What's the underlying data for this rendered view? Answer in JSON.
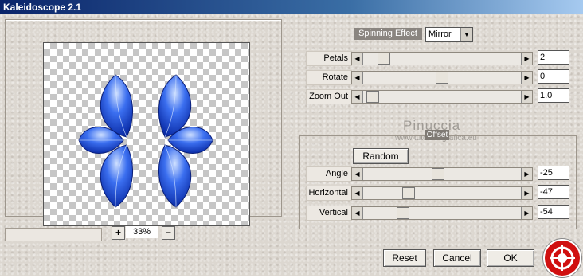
{
  "window": {
    "title": "Kaleidoscope 2.1"
  },
  "preview": {
    "zoom_minus": "−",
    "zoom_plus": "+",
    "zoom_value": "33%"
  },
  "effect": {
    "label": "Spinning Effect",
    "mode": "Mirror"
  },
  "params": {
    "petals": {
      "label": "Petals",
      "value": "2",
      "level": 0.1
    },
    "rotate": {
      "label": "Rotate",
      "value": "0",
      "level": 0.5
    },
    "zoom_out": {
      "label": "Zoom Out",
      "value": "1.0",
      "level": 0.02
    }
  },
  "offset": {
    "legend": "Offset",
    "random_label": "Random",
    "angle": {
      "label": "Angle",
      "value": "-25",
      "level": 0.47
    },
    "horizontal": {
      "label": "Horizontal",
      "value": "-47",
      "level": 0.27
    },
    "vertical": {
      "label": "Vertical",
      "value": "-54",
      "level": 0.23
    }
  },
  "watermark": {
    "name": "Pinuccia",
    "site": "www.tutorialsgrafica.eu"
  },
  "buttons": {
    "reset": "Reset",
    "cancel": "Cancel",
    "ok": "OK"
  },
  "colors": {
    "petal_blue": "#1e4fd8",
    "petal_light": "#a9c8ff",
    "logo_red": "#d01010"
  },
  "icons": {
    "scroll_left": "left-arrow-icon",
    "scroll_right": "right-arrow-icon",
    "logo": "target-logo-icon"
  }
}
